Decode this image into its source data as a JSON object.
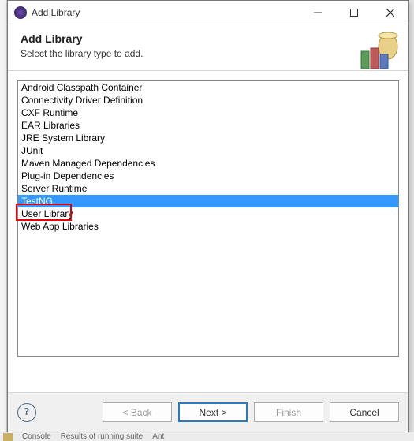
{
  "titlebar": {
    "title": "Add Library"
  },
  "header": {
    "title": "Add Library",
    "subtitle": "Select the library type to add."
  },
  "list": {
    "items": [
      "Android Classpath Container",
      "Connectivity Driver Definition",
      "CXF Runtime",
      "EAR Libraries",
      "JRE System Library",
      "JUnit",
      "Maven Managed Dependencies",
      "Plug-in Dependencies",
      "Server Runtime",
      "TestNG",
      "User Library",
      "Web App Libraries"
    ],
    "selected_index": 9
  },
  "footer": {
    "back": "< Back",
    "next": "Next >",
    "finish": "Finish",
    "cancel": "Cancel"
  },
  "bg": {
    "tab1": "Console",
    "tab2": "Results of running suite",
    "tab3": "Ant"
  }
}
